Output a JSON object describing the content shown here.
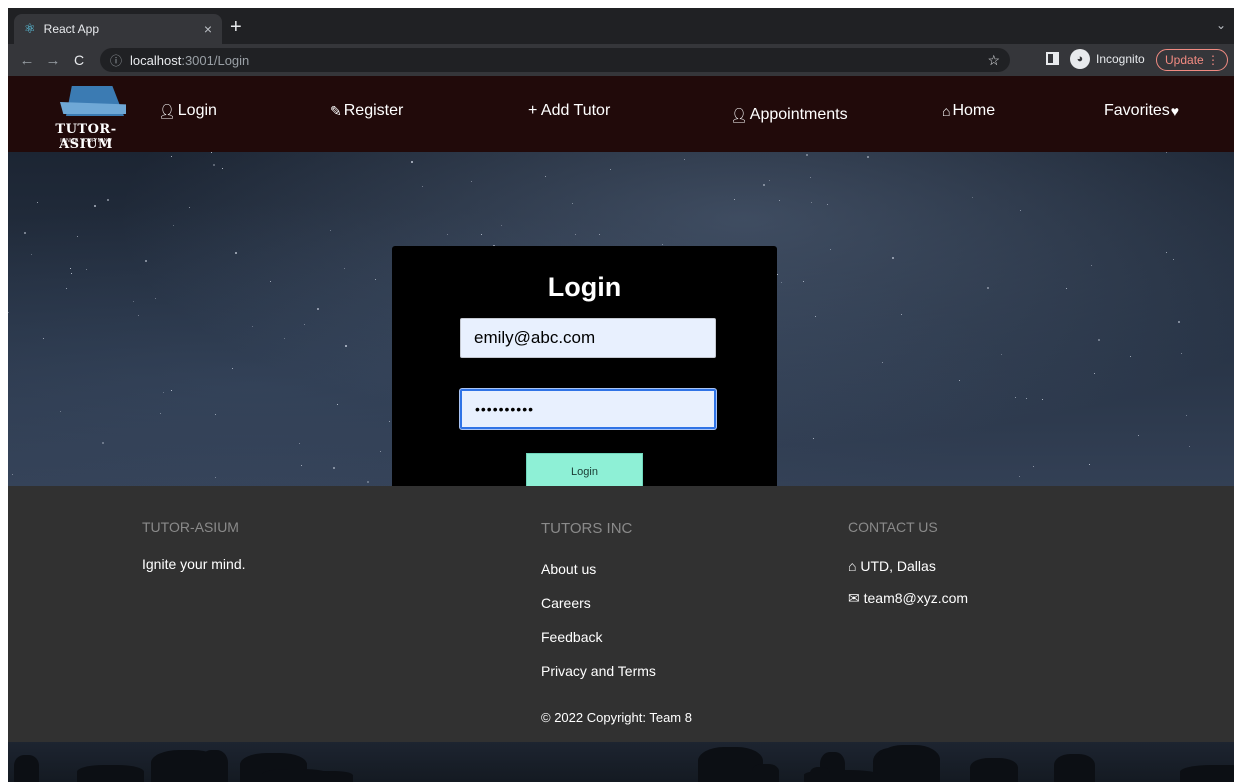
{
  "browser": {
    "tab_title": "React App",
    "tab_close": "×",
    "new_tab": "+",
    "tab_menu": "⌄",
    "back": "←",
    "forward": "→",
    "reload": "C",
    "url_host": "localhost",
    "url_path": ":3001/Login",
    "info_icon": "ⓘ",
    "star_icon": "☆",
    "incognito_label": "Incognito",
    "update_label": "Update ⋮"
  },
  "logo": {
    "text": "TUTOR-ASIUM",
    "subtext": "IGNITE YOUR MIND"
  },
  "nav": {
    "login": "Login",
    "register": "Register",
    "add_tutor": "+ Add Tutor",
    "appointments": "Appointments",
    "home": "Home",
    "favorites": "Favorites"
  },
  "login_form": {
    "title": "Login",
    "email_value": "emily@abc.com",
    "password_value": "••••••••••",
    "button_label": "Login"
  },
  "footer": {
    "brand_heading": "TUTOR-ASIUM",
    "tagline": "Ignite your mind.",
    "company_heading": "TUTORS INC",
    "links": [
      "About us",
      "Careers",
      "Feedback",
      "Privacy and Terms"
    ],
    "contact_heading": "CONTACT US",
    "address": "UTD, Dallas",
    "email": "team8@xyz.com",
    "copyright": "© 2022 Copyright: Team 8"
  },
  "colors": {
    "navbar_bg": "#210a0a",
    "login_button": "#8ef0d6",
    "footer_bg": "#313131",
    "card_bg": "#000000"
  }
}
